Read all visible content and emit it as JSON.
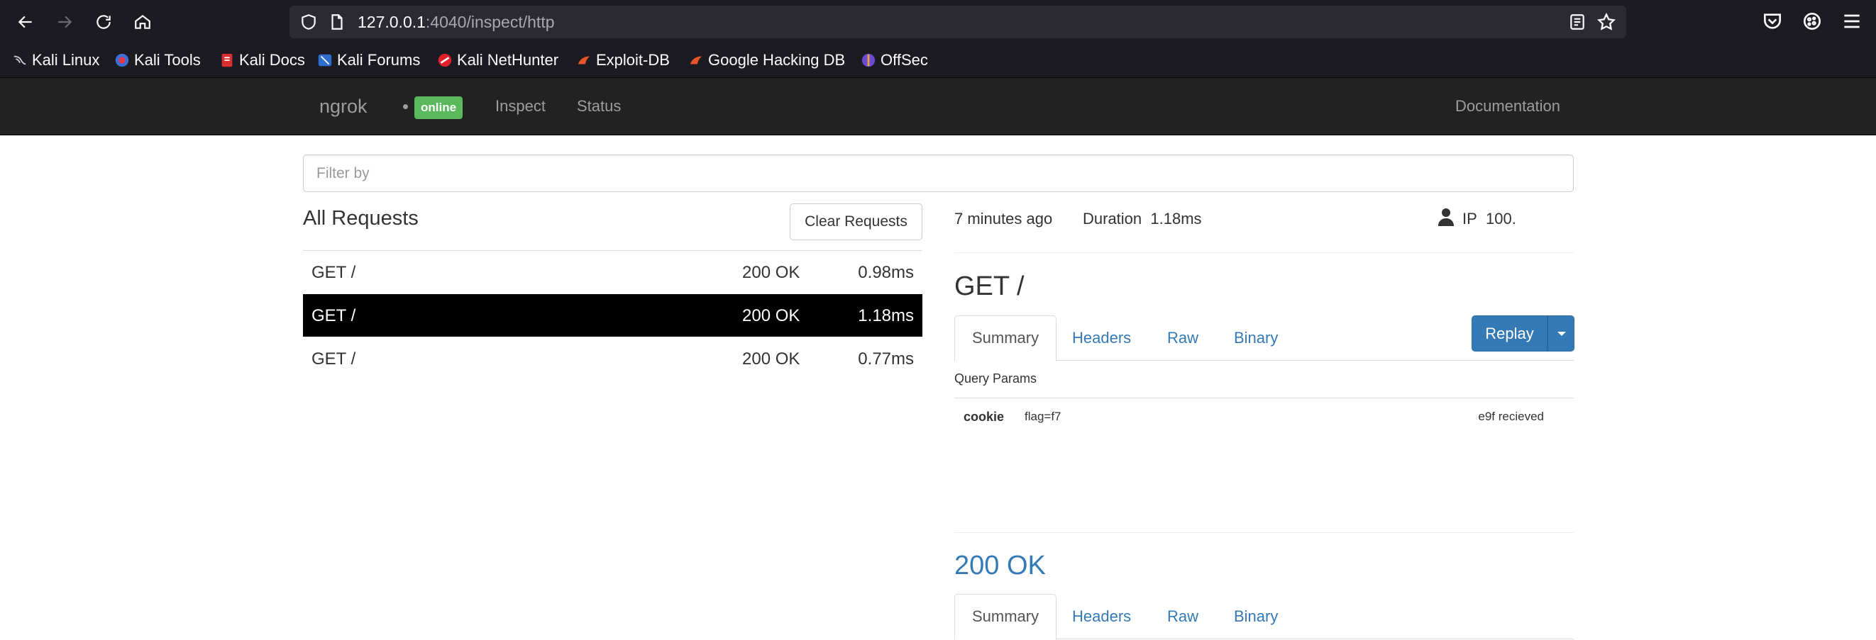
{
  "browser": {
    "url_host": "127.0.0.1",
    "url_rest": ":4040/inspect/http",
    "bookmarks": [
      {
        "label": "Kali Linux",
        "icon": "kali-dragon-icon"
      },
      {
        "label": "Kali Tools",
        "icon": "kali-tools-icon"
      },
      {
        "label": "Kali Docs",
        "icon": "kali-docs-icon"
      },
      {
        "label": "Kali Forums",
        "icon": "kali-forums-icon"
      },
      {
        "label": "Kali NetHunter",
        "icon": "nethunter-icon"
      },
      {
        "label": "Exploit-DB",
        "icon": "exploit-db-icon"
      },
      {
        "label": "Google Hacking DB",
        "icon": "ghdb-icon"
      },
      {
        "label": "OffSec",
        "icon": "offsec-icon"
      }
    ]
  },
  "navbar": {
    "brand": "ngrok",
    "status_badge": "online",
    "links": [
      "Inspect",
      "Status"
    ],
    "docs": "Documentation"
  },
  "filter": {
    "placeholder": "Filter by"
  },
  "requests": {
    "title": "All Requests",
    "clear_label": "Clear Requests",
    "rows": [
      {
        "method_path": "GET /",
        "status": "200 OK",
        "duration": "0.98ms"
      },
      {
        "method_path": "GET /",
        "status": "200 OK",
        "duration": "1.18ms"
      },
      {
        "method_path": "GET /",
        "status": "200 OK",
        "duration": "0.77ms"
      }
    ]
  },
  "detail": {
    "time_ago": "7 minutes ago",
    "duration_label": "Duration",
    "duration_value": "1.18ms",
    "ip_label": "IP",
    "ip_value": "100.",
    "request_title": "GET /",
    "tabs": [
      "Summary",
      "Headers",
      "Raw",
      "Binary"
    ],
    "replay_label": "Replay",
    "query_params_label": "Query Params",
    "param_key": "cookie",
    "param_value_start": "flag=f7",
    "param_value_end": "e9f recieved",
    "response_title": "200 OK",
    "response_tabs": [
      "Summary",
      "Headers",
      "Raw",
      "Binary"
    ]
  },
  "colors": {
    "navbar_bg": "#222222",
    "online_badge": "#5cb85c",
    "link_blue": "#337ab7",
    "selected_row": "#000000"
  }
}
